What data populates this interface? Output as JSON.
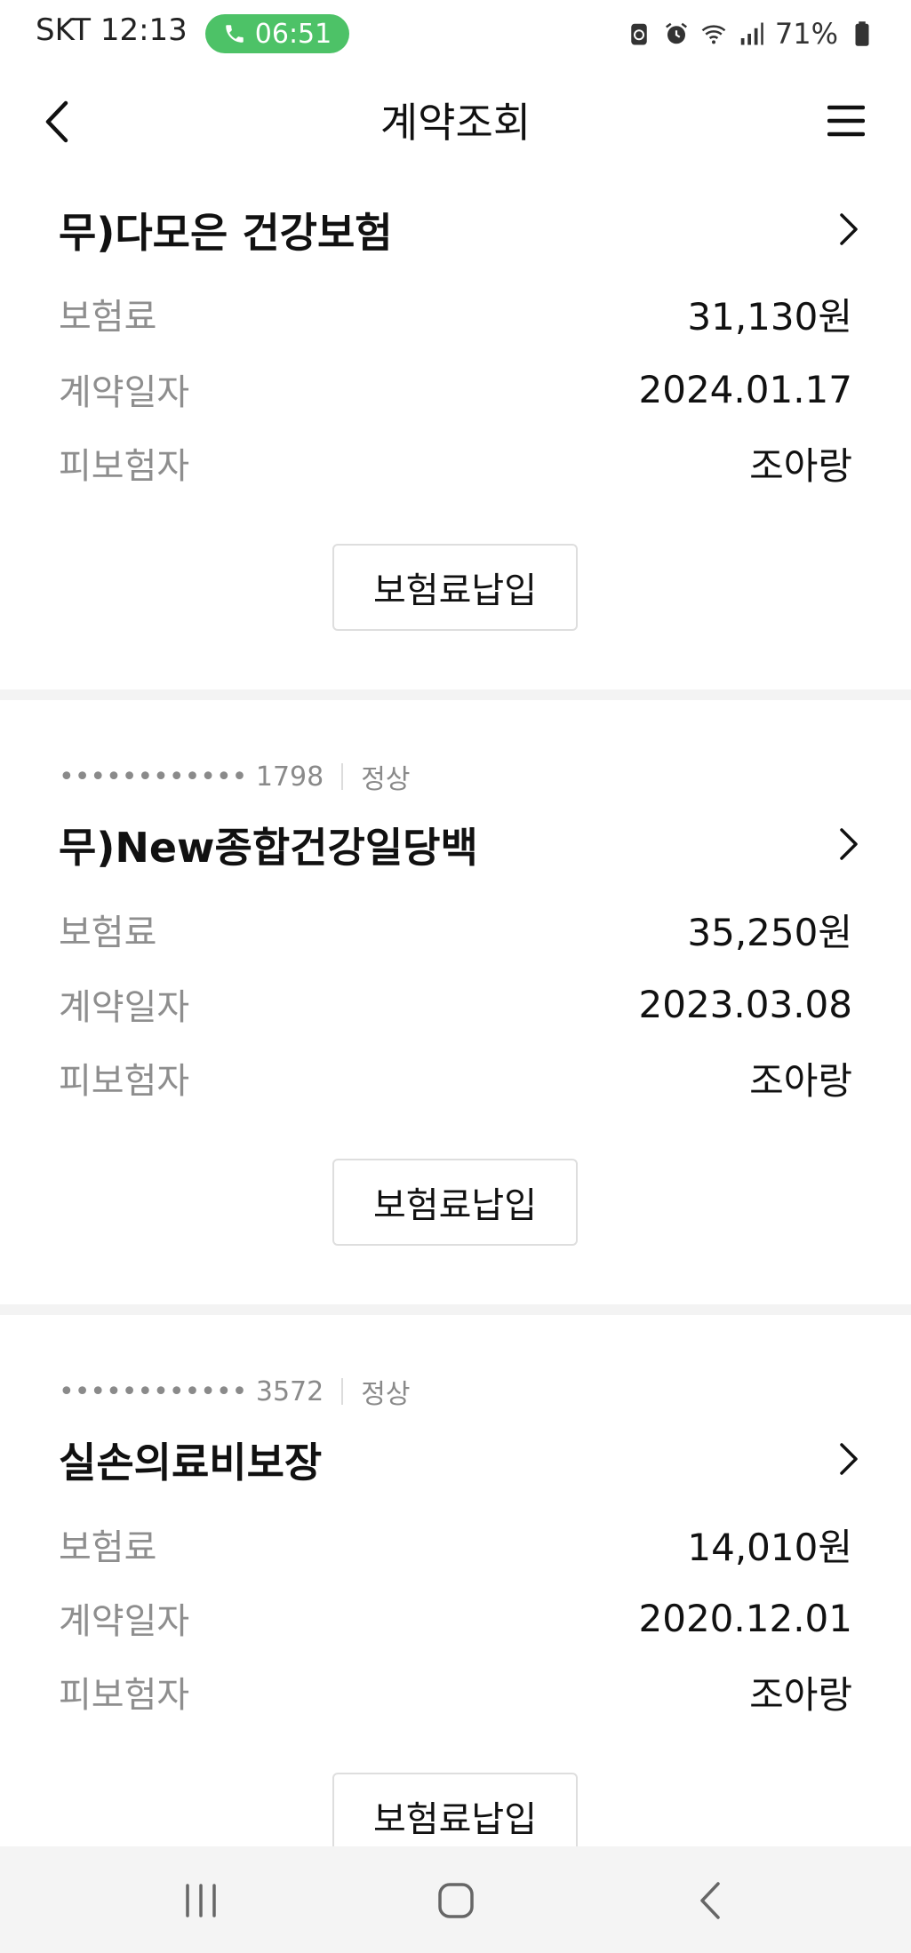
{
  "status_bar": {
    "carrier_time": "SKT 12:13",
    "call_timer": "06:51",
    "battery": "71%"
  },
  "header": {
    "title": "계약조회"
  },
  "contracts": [
    {
      "product": "무)다모은 건강보험",
      "rows": [
        {
          "label": "보험료",
          "value": "31,130원"
        },
        {
          "label": "계약일자",
          "value": "2024.01.17"
        },
        {
          "label": "피보험자",
          "value": "조아랑"
        }
      ],
      "button": "보험료납입"
    },
    {
      "masked_number": "•••••••••••• 1798",
      "status": "정상",
      "product": "무)New종합건강일당백",
      "rows": [
        {
          "label": "보험료",
          "value": "35,250원"
        },
        {
          "label": "계약일자",
          "value": "2023.03.08"
        },
        {
          "label": "피보험자",
          "value": "조아랑"
        }
      ],
      "button": "보험료납입"
    },
    {
      "masked_number": "•••••••••••• 3572",
      "status": "정상",
      "product": "실손의료비보장",
      "rows": [
        {
          "label": "보험료",
          "value": "14,010원"
        },
        {
          "label": "계약일자",
          "value": "2020.12.01"
        },
        {
          "label": "피보험자",
          "value": "조아랑"
        }
      ],
      "button": "보험료납입"
    }
  ],
  "icons": {
    "back": "back-arrow-icon",
    "menu": "hamburger-menu-icon",
    "chevron": "chevron-right-icon",
    "nav_recent": "recent-apps-icon",
    "nav_home": "home-icon",
    "nav_back": "nav-back-icon"
  },
  "colors": {
    "call_pill": "#4dc267",
    "divider": "#f3f3f3",
    "nav_bar": "#f4f4f4"
  }
}
